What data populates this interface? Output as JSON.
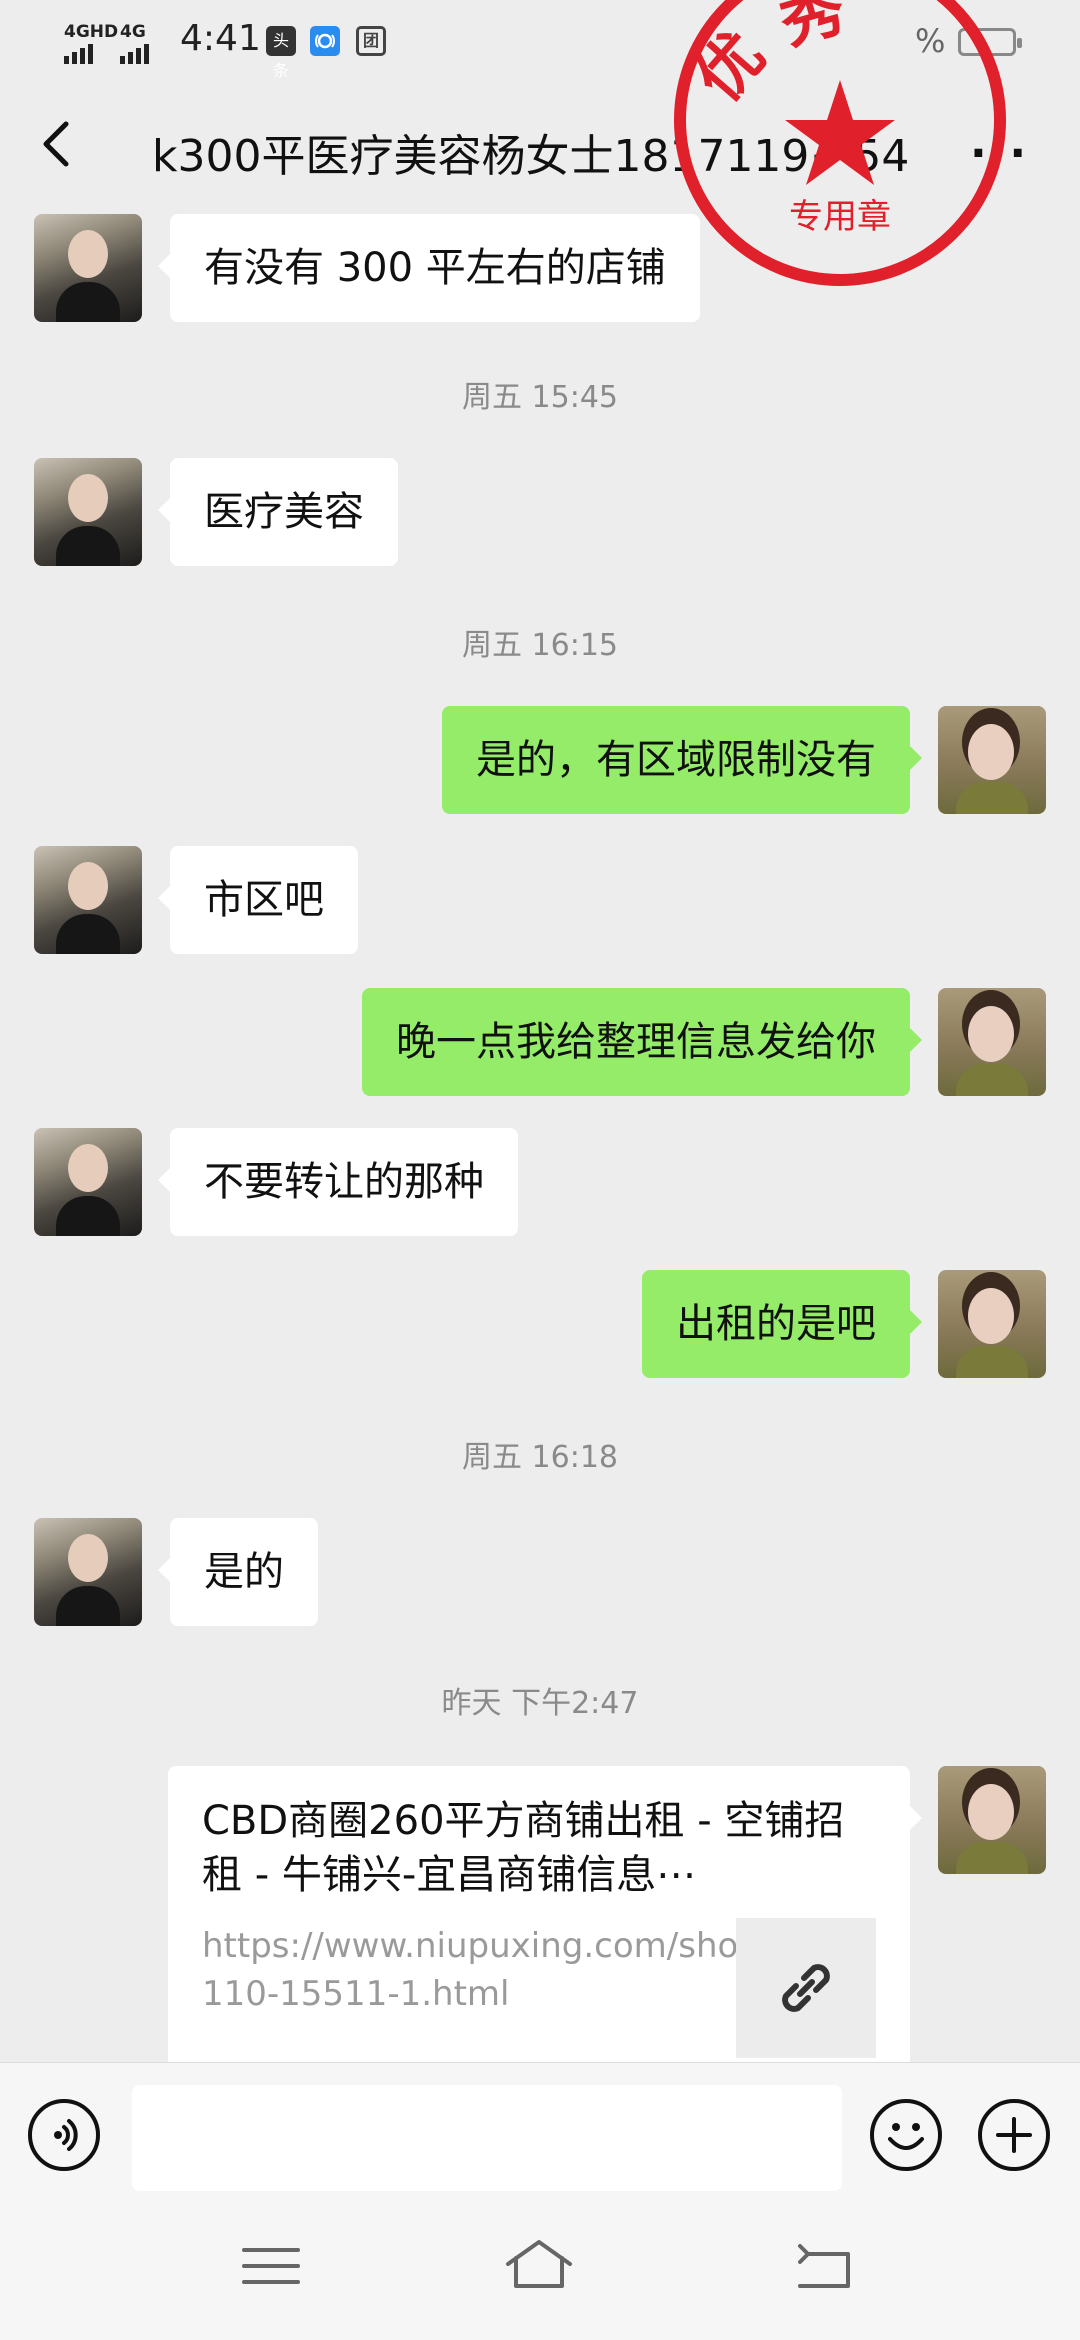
{
  "status_bar": {
    "signal1_label": "4GHD",
    "signal2_label": "4G",
    "time": "4:41",
    "app_badge_1": "头条",
    "app_badge_3": "团",
    "battery_text": "%"
  },
  "header": {
    "title": "k300平医疗美容杨女士1817119⋯54"
  },
  "stamp": {
    "text_top": "优 秀",
    "text_bottom": "专用章",
    "color": "#e0202a"
  },
  "messages": [
    {
      "side": "left",
      "text": "有没有 300 平左右的店铺"
    },
    {
      "type": "time",
      "text": "周五 15:45"
    },
    {
      "side": "left",
      "text": "医疗美容"
    },
    {
      "type": "time",
      "text": "周五 16:15"
    },
    {
      "side": "right",
      "text": "是的，有区域限制没有"
    },
    {
      "side": "left",
      "text": "市区吧"
    },
    {
      "side": "right",
      "text": "晚一点我给整理信息发给你"
    },
    {
      "side": "left",
      "text": "不要转让的那种"
    },
    {
      "side": "right",
      "text": "出租的是吧"
    },
    {
      "type": "time",
      "text": "周五 16:18"
    },
    {
      "side": "left",
      "text": "是的"
    },
    {
      "type": "time",
      "text": "昨天 下午2:47"
    }
  ],
  "link_card": {
    "title": "CBD商圈260平方商铺出租 - 空铺招租 - 牛铺兴-宜昌商铺信息⋯",
    "url": "https://www.niupuxing.com/show-110-15511-1.html"
  },
  "input_bar": {
    "input_value": ""
  },
  "colors": {
    "bubble_self": "#95ec69",
    "bubble_other": "#ffffff",
    "background": "#ededed"
  },
  "icons": [
    "back-icon",
    "more-icon",
    "voice-icon",
    "emoji-icon",
    "plus-icon",
    "menu-icon",
    "home-icon",
    "return-icon",
    "link-icon"
  ]
}
